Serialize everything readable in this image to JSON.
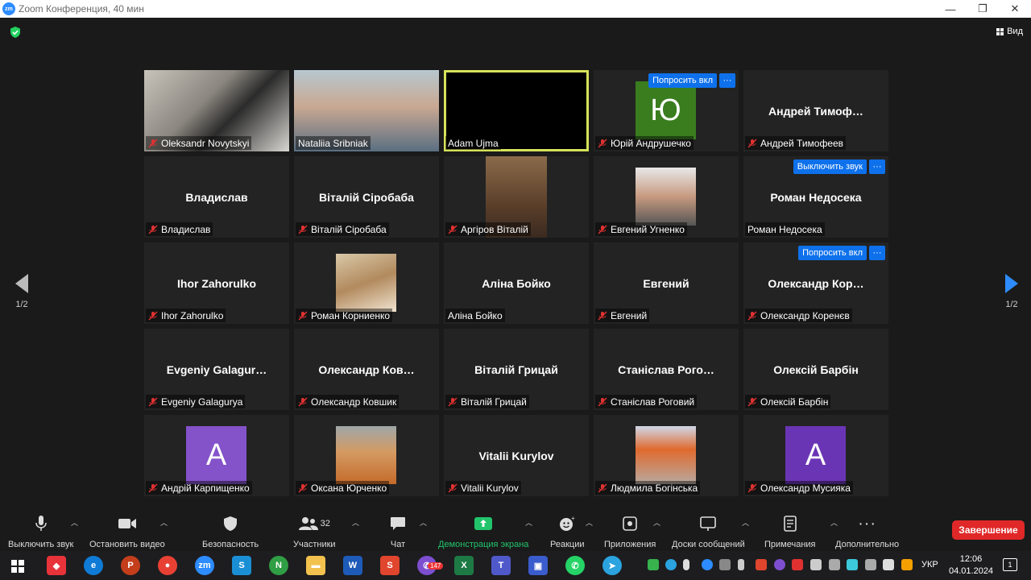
{
  "window": {
    "title": "Zoom Конференция, 40 мин",
    "app_icon": "zm",
    "buttons": [
      "minimize",
      "restore",
      "close"
    ]
  },
  "top": {
    "view_label": "Вид",
    "security_color": "#23d160"
  },
  "pager": {
    "left_label": "1/2",
    "right_label": "1/2"
  },
  "tiles": [
    {
      "name": "Oleksandr Novytskyi",
      "muted": true,
      "type": "video"
    },
    {
      "name": "Nataliia Sribniak",
      "muted": false,
      "type": "video"
    },
    {
      "name": "Adam Ujma",
      "muted": false,
      "type": "black",
      "active": true
    },
    {
      "name": "Юрій Андрушечко",
      "muted": true,
      "type": "avatar",
      "letter": "Ю",
      "avatar_color": "#3a7d1f",
      "action": "Попросить вкл",
      "more": "···"
    },
    {
      "name": "Андрей Тимофеев",
      "display": "Андрей  Тимоф…",
      "muted": true,
      "type": "text"
    },
    {
      "name": "Владислав",
      "display": "Владислав",
      "muted": true,
      "type": "text"
    },
    {
      "name": "Віталій Сіробаба",
      "display": "Віталій Сіробаба",
      "muted": true,
      "type": "text"
    },
    {
      "name": "Аргіров Віталій",
      "muted": true,
      "type": "video"
    },
    {
      "name": "Евгений Угненко",
      "muted": true,
      "type": "photo"
    },
    {
      "name": "Роман Недосека",
      "display": "Роман Недосека",
      "muted": false,
      "type": "text",
      "action": "Выключить звук",
      "more": "···"
    },
    {
      "name": "Ihor Zahorulko",
      "display": "Ihor Zahorulko",
      "muted": true,
      "type": "text"
    },
    {
      "name": "Роман Корниенко",
      "muted": true,
      "type": "photo"
    },
    {
      "name": "Аліна Бойко",
      "display": "Аліна Бойко",
      "muted": false,
      "type": "text"
    },
    {
      "name": "Евгений",
      "display": "Евгений",
      "muted": true,
      "type": "text"
    },
    {
      "name": "Олександр Коренєв",
      "display": "Олександр  Кор…",
      "muted": true,
      "type": "text",
      "action": "Попросить вкл",
      "more": "···"
    },
    {
      "name": "Evgeniy Galagurya",
      "display": "Evgeniy  Galagur…",
      "muted": true,
      "type": "text"
    },
    {
      "name": "Олександр Ковшик",
      "display": "Олександр  Ков…",
      "muted": true,
      "type": "text"
    },
    {
      "name": "Віталій Грицай",
      "display": "Віталій Грицай",
      "muted": true,
      "type": "text"
    },
    {
      "name": "Станіслав Роговий",
      "display": "Станіслав  Рого…",
      "muted": true,
      "type": "text"
    },
    {
      "name": "Олексій Барбін",
      "display": "Олексій Барбін",
      "muted": true,
      "type": "text"
    },
    {
      "name": "Андрій Карпищенко",
      "muted": true,
      "type": "avatar",
      "letter": "A",
      "avatar_color": "#8452c9"
    },
    {
      "name": "Оксана Юрченко",
      "muted": true,
      "type": "photo"
    },
    {
      "name": "Vitalii Kurylov",
      "display": "Vitalii Kurylov",
      "muted": true,
      "type": "text"
    },
    {
      "name": "Людмила Богінська",
      "muted": true,
      "type": "photo"
    },
    {
      "name": "Олександр Мусияка",
      "muted": true,
      "type": "avatar",
      "letter": "A",
      "avatar_color": "#6a35b5"
    }
  ],
  "toolbar": {
    "mute": "Выключить звук",
    "video": "Остановить видео",
    "security": "Безопасность",
    "participants": "Участники",
    "participants_count": "32",
    "chat": "Чат",
    "share": "Демонстрация экрана",
    "reactions": "Реакции",
    "apps": "Приложения",
    "whiteboards": "Доски сообщений",
    "notes": "Примечания",
    "more": "Дополнительно",
    "end": "Завершение"
  },
  "taskbar": {
    "lang": "УКР",
    "time": "12:06",
    "date": "04.01.2024",
    "viber_badge": "147",
    "notification_count": "1"
  }
}
